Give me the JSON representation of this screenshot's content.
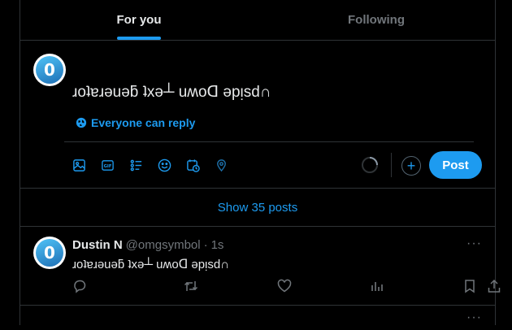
{
  "tabs": [
    {
      "label": "For you",
      "active": true
    },
    {
      "label": "Following",
      "active": false
    }
  ],
  "composer": {
    "avatar_letter": "0",
    "text": "ɹoʇɐɹǝuǝƃ ʇxǝ┴ uʍoᗡ ǝpᴉsd∩",
    "reply_setting": "Everyone can reply",
    "tools": [
      "image-icon",
      "gif-icon",
      "poll-icon",
      "emoji-icon",
      "schedule-icon",
      "location-icon"
    ],
    "post_label": "Post",
    "add_symbol": "+"
  },
  "show_posts": "Show 35 posts",
  "tweet": {
    "avatar_letter": "0",
    "name": "Dustin N",
    "handle": "@omgsymbol",
    "separator": "·",
    "time": "1s",
    "text": "ɹoʇɐɹǝuǝƃ ʇxǝ┴ uʍoᗡ ǝpᴉsd∩",
    "more": "···"
  },
  "tweet2": {
    "more": "···"
  },
  "colors": {
    "accent": "#1d9bf0",
    "muted": "#71767b",
    "border": "#2f3336",
    "text": "#e7e9ea",
    "background": "#000000"
  }
}
